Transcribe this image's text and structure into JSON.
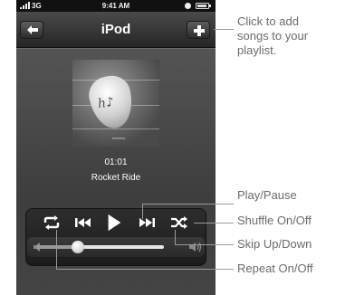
{
  "status_bar": {
    "network": "3G",
    "time": "9:41 AM"
  },
  "nav": {
    "title": "iPod"
  },
  "now_playing": {
    "elapsed": "01:01",
    "title": "Rocket Ride"
  },
  "volume": {
    "level": 0.32
  },
  "callouts": {
    "add": [
      "Click to add",
      "songs to your",
      "playlist."
    ],
    "play_pause": "Play/Pause",
    "shuffle": "Shuffle On/Off",
    "skip": "Skip Up/Down",
    "repeat": "Repeat On/Off"
  },
  "icons": [
    "signal-icon",
    "lock-icon",
    "battery-icon",
    "back-arrow-icon",
    "plus-icon",
    "repeat-icon",
    "previous-icon",
    "play-icon",
    "next-icon",
    "shuffle-icon",
    "volume-low-icon",
    "volume-high-icon"
  ]
}
